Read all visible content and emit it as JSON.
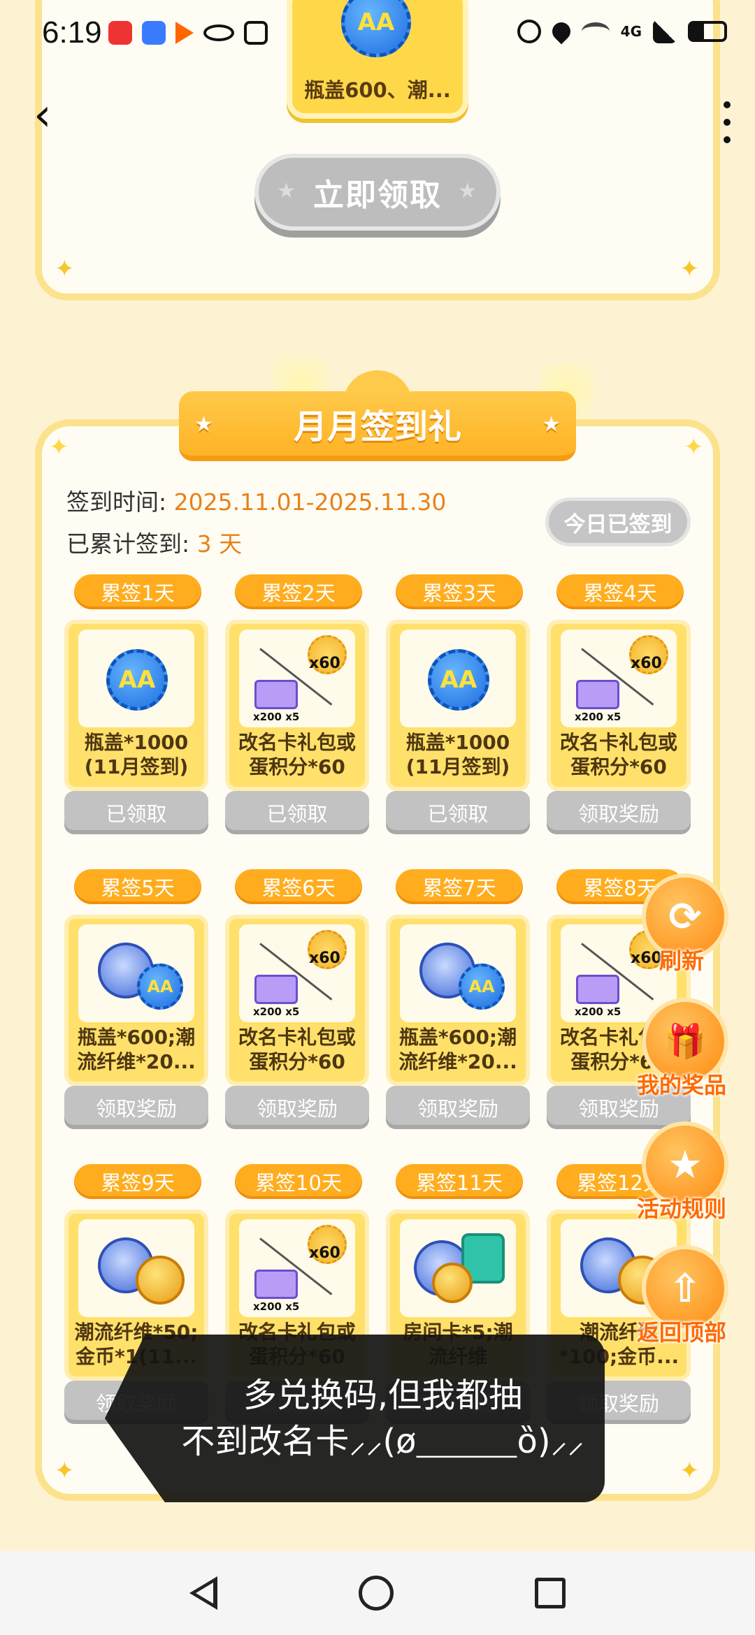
{
  "status_bar": {
    "time": "6:19",
    "network": "4G",
    "icons": [
      "red-app-icon",
      "blue-chat-icon",
      "play-icon",
      "eye-icon",
      "nfc-icon",
      "alarm-icon",
      "location-icon",
      "wifi-icon",
      "signal-icon",
      "battery-icon"
    ]
  },
  "top_section": {
    "prize_label": "瓶盖600、潮...",
    "claim_button": "立即领取"
  },
  "monthly": {
    "title": "月月签到礼",
    "period_label": "签到时间:",
    "period_value": "2025.11.01-2025.11.30",
    "cumulative_label": "已累计签到:",
    "cumulative_value": "3 天",
    "today_button": "今日已签到"
  },
  "rewards": [
    {
      "day": "累签1天",
      "icon": "bottle-cap-icon",
      "name": "瓶盖*1000\n(11月签到)",
      "button": "已领取"
    },
    {
      "day": "累签2天",
      "icon": "rename-card-icon",
      "name": "改名卡礼包或\n蛋积分*60",
      "button": "已领取"
    },
    {
      "day": "累签3天",
      "icon": "bottle-cap-icon",
      "name": "瓶盖*1000\n(11月签到)",
      "button": "已领取"
    },
    {
      "day": "累签4天",
      "icon": "rename-card-icon",
      "name": "改名卡礼包或\n蛋积分*60",
      "button": "领取奖励"
    },
    {
      "day": "累签5天",
      "icon": "fiber-cap-icon",
      "name": "瓶盖*600;潮\n流纤维*20...",
      "button": "领取奖励"
    },
    {
      "day": "累签6天",
      "icon": "rename-card-icon",
      "name": "改名卡礼包或\n蛋积分*60",
      "button": "领取奖励"
    },
    {
      "day": "累签7天",
      "icon": "fiber-cap-icon",
      "name": "瓶盖*600;潮\n流纤维*20...",
      "button": "领取奖励"
    },
    {
      "day": "累签8天",
      "icon": "rename-card-icon",
      "name": "改名卡礼包或\n蛋积分*60",
      "button": "领取奖励"
    },
    {
      "day": "累签9天",
      "icon": "fiber-coin-icon",
      "name": "潮流纤维*50;\n金币*1(11...",
      "button": "领取奖励"
    },
    {
      "day": "累签10天",
      "icon": "rename-card-icon",
      "name": "改名卡礼包或\n蛋积分*60",
      "button": "领取奖励"
    },
    {
      "day": "累签11天",
      "icon": "room-card-icon",
      "name": "房间卡*5;潮\n流纤维*100...",
      "button": "领取奖励"
    },
    {
      "day": "累签12天",
      "icon": "fiber-coin-icon",
      "name": "潮流纤维\n*100;金币...",
      "button": "领取奖励"
    }
  ],
  "rename_icon_text": {
    "count": "x60",
    "note": "x200 x5"
  },
  "cap_text": "AA",
  "float_buttons": [
    {
      "label": "刷新",
      "icon": "refresh-icon",
      "glyph": "⟳"
    },
    {
      "label": "我的奖品",
      "icon": "gift-icon",
      "glyph": "🎁"
    },
    {
      "label": "活动规则",
      "icon": "rules-icon",
      "glyph": "★"
    },
    {
      "label": "返回顶部",
      "icon": "back-to-top-icon",
      "glyph": "⇧"
    }
  ],
  "caption": "多兑换码,但我都抽\n不到改名卡⸝⸝(ø⸏⸏⸏ȍ)⸝⸝"
}
